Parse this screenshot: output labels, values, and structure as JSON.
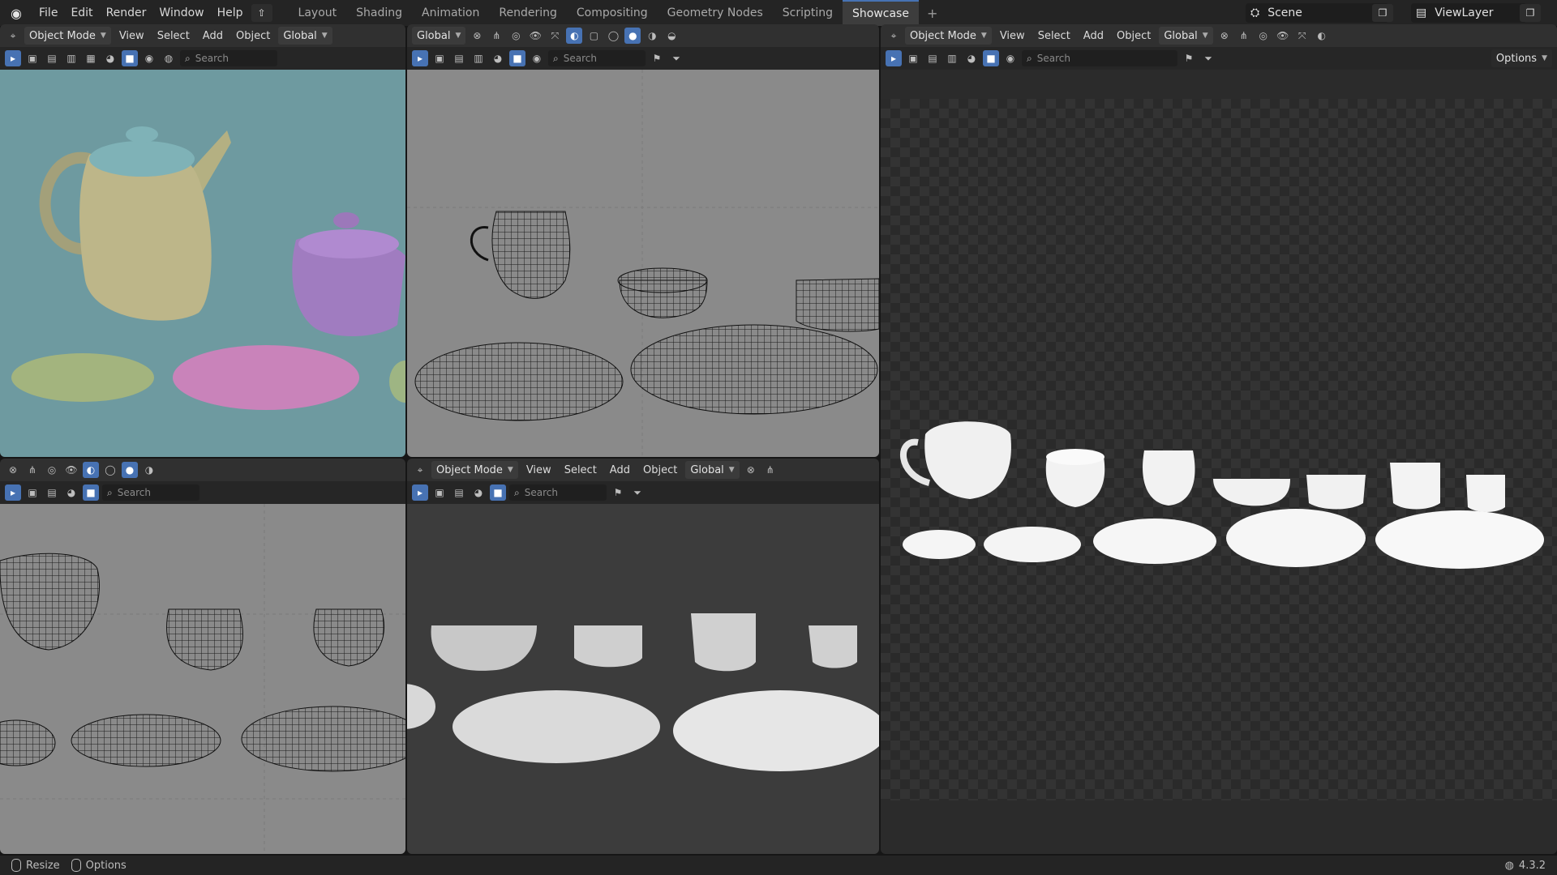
{
  "app": {
    "menus": [
      "File",
      "Edit",
      "Render",
      "Window",
      "Help"
    ],
    "workspaces": [
      "Layout",
      "Shading",
      "Animation",
      "Rendering",
      "Compositing",
      "Geometry Nodes",
      "Scripting",
      "Showcase"
    ],
    "active_workspace": "Showcase",
    "add_tab": "+",
    "scene_name": "Scene",
    "view_layer": "ViewLayer"
  },
  "viewport_header": {
    "mode": "Object Mode",
    "view": "View",
    "select": "Select",
    "add": "Add",
    "object": "Object",
    "transform": "Global",
    "search_placeholder": "Search",
    "options": "Options"
  },
  "status_bar": {
    "resize": "Resize",
    "options": "Options",
    "version": "4.3.2"
  },
  "colors": {
    "accent": "#4772b3",
    "solid_bg": "#6e9aa0",
    "wire_bg": "#8a8a8a",
    "render_bg": "#3c3c3c"
  }
}
